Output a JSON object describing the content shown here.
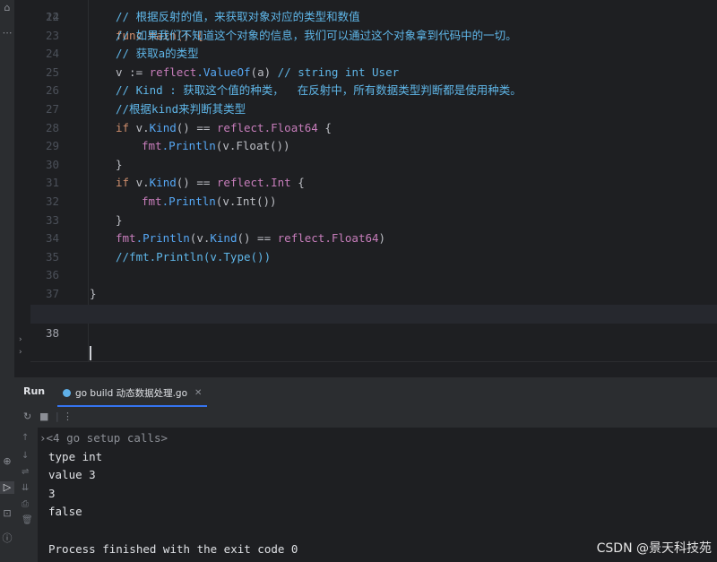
{
  "editor": {
    "partial_top_line": "func main() {",
    "lines": [
      {
        "num": "22",
        "kind": "comment",
        "text": "// 根据反射的值，来获取对象对应的类型和数值"
      },
      {
        "num": "23",
        "kind": "comment",
        "text": "// 如果我们不知道这个对象的信息，我们可以通过这个对象拿到代码中的一切。"
      },
      {
        "num": "24",
        "kind": "comment",
        "text": "// 获取a的类型"
      },
      {
        "num": "25",
        "kind": "assign",
        "left": "v := ",
        "pkg": "reflect",
        "fn": ".ValueOf",
        "arg": "(a) ",
        "comment": "// string int User"
      },
      {
        "num": "26",
        "kind": "comment",
        "text": "// Kind : 获取这个值的种类，  在反射中，所有数据类型判断都是使用种类。"
      },
      {
        "num": "27",
        "kind": "comment",
        "text": "//根据kind来判断其类型"
      },
      {
        "num": "28",
        "kind": "if",
        "text_kw": "if ",
        "text_v": "v.",
        "text_fn": "Kind",
        "text_mid": "() == ",
        "text_pkg": "reflect",
        "text_type": ".Float64",
        "text_end": " {"
      },
      {
        "num": "29",
        "kind": "call",
        "pkg": "fmt",
        "fn": ".Println",
        "args": "(v.Float())"
      },
      {
        "num": "30",
        "kind": "close",
        "text": "}"
      },
      {
        "num": "31",
        "kind": "if",
        "text_kw": "if ",
        "text_v": "v.",
        "text_fn": "Kind",
        "text_mid": "() == ",
        "text_pkg": "reflect",
        "text_type": ".Int",
        "text_end": " {"
      },
      {
        "num": "32",
        "kind": "call",
        "pkg": "fmt",
        "fn": ".Println",
        "args": "(v.Int())"
      },
      {
        "num": "33",
        "kind": "close",
        "text": "}"
      },
      {
        "num": "34",
        "kind": "println_kind",
        "pkg": "fmt",
        "fn": ".Println",
        "args1": "(v.",
        "fn2": "Kind",
        "args2": "() == ",
        "pkg2": "reflect",
        "type": ".Float64",
        "end": ")"
      },
      {
        "num": "35",
        "kind": "comment",
        "text": "//fmt.Println(v.Type())"
      },
      {
        "num": "36",
        "kind": "empty",
        "text": ""
      },
      {
        "num": "37",
        "kind": "close",
        "text": "}"
      },
      {
        "num": "38",
        "kind": "current",
        "text": ""
      }
    ]
  },
  "run_panel": {
    "title": "Run",
    "tab_label": "go build 动态数据处理.go",
    "console_lines": [
      "<4 go setup calls>",
      "type int",
      "value 3",
      "3",
      "false",
      "",
      "Process finished with the exit code 0"
    ]
  },
  "watermark": "CSDN @景天科技苑"
}
